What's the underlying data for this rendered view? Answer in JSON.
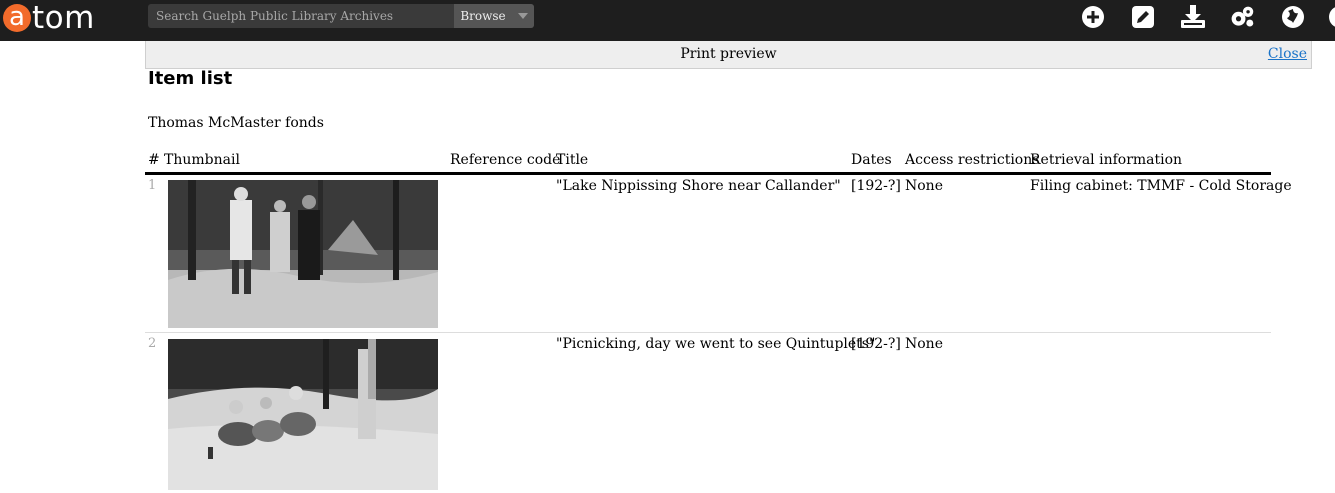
{
  "logo": {
    "mark": "a",
    "rest": "tom"
  },
  "search": {
    "placeholder": "Search Guelph Public Library Archives"
  },
  "browse": {
    "label": "Browse"
  },
  "nav_icons": [
    "add-icon",
    "edit-icon",
    "download-icon",
    "settings-icon",
    "language-icon"
  ],
  "print_preview": {
    "title": "Print preview",
    "close_label": "Close"
  },
  "page": {
    "heading": "Item list",
    "fonds": "Thomas McMaster fonds"
  },
  "table": {
    "headers": [
      "#",
      "Thumbnail",
      "Reference code",
      "Title",
      "Dates",
      "Access restrictions",
      "Retrieval information"
    ],
    "rows": [
      {
        "num": "1",
        "reference_code": "",
        "title": "\"Lake Nippissing Shore near Callander\"",
        "dates": "[192-?]",
        "access": "None",
        "retrieval": "Filing cabinet: TMMF - Cold Storage"
      },
      {
        "num": "2",
        "reference_code": "",
        "title": "\"Picnicking, day we went to see Quintuplets\"",
        "dates": "[192-?]",
        "access": "None",
        "retrieval": ""
      }
    ]
  },
  "colors": {
    "topbar": "#1e1e1e",
    "logo_orange": "#f26b2b",
    "link": "#1a73c8",
    "preview_bar": "#eeeeee"
  }
}
